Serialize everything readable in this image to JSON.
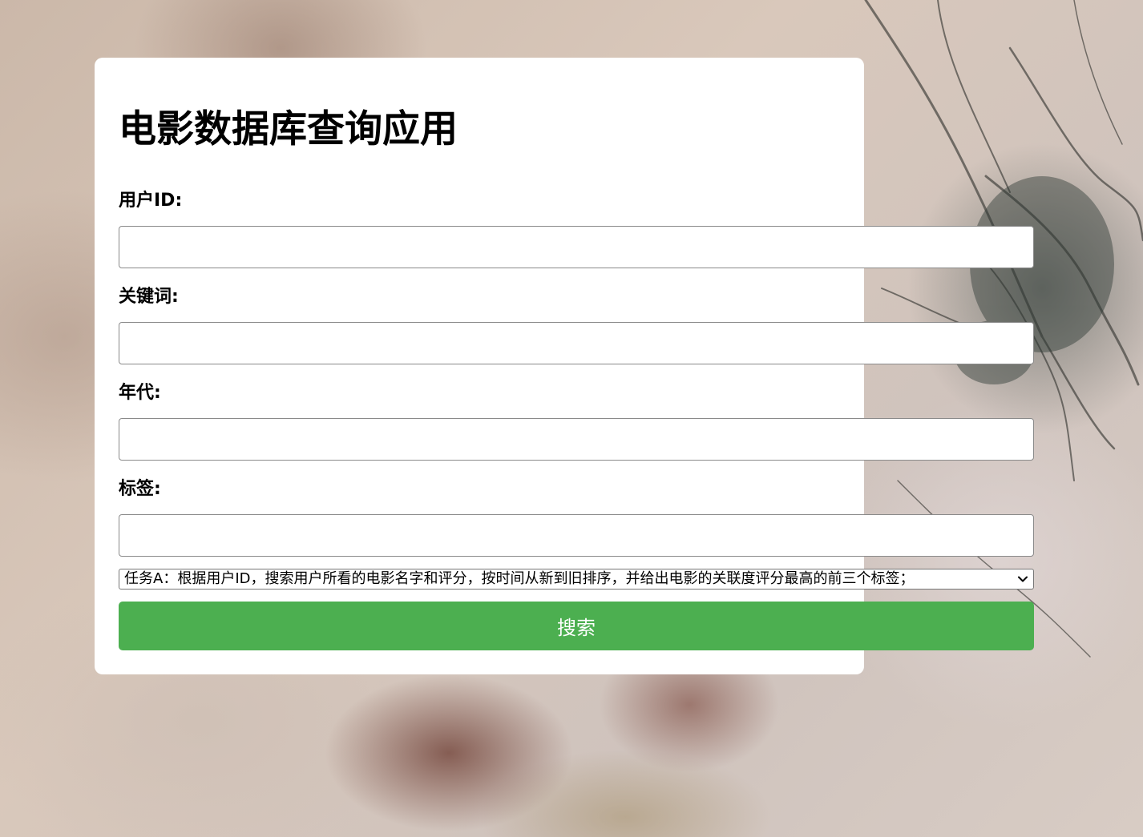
{
  "page": {
    "title": "电影数据库查询应用"
  },
  "form": {
    "user_id_label": "用户ID:",
    "user_id_value": "",
    "keyword_label": "关键词:",
    "keyword_value": "",
    "year_label": "年代:",
    "year_value": "",
    "tag_label": "标签:",
    "tag_value": "",
    "task_select": {
      "selected": "任务A：根据用户ID，搜索用户所看的电影名字和评分，按时间从新到旧排序，并给出电影的关联度评分最高的前三个标签；"
    },
    "search_button_label": "搜索"
  },
  "colors": {
    "button_bg": "#4caf50",
    "button_text": "#ffffff",
    "card_bg": "#ffffff"
  },
  "icons": {
    "select_arrow": "chevron-down-icon"
  }
}
